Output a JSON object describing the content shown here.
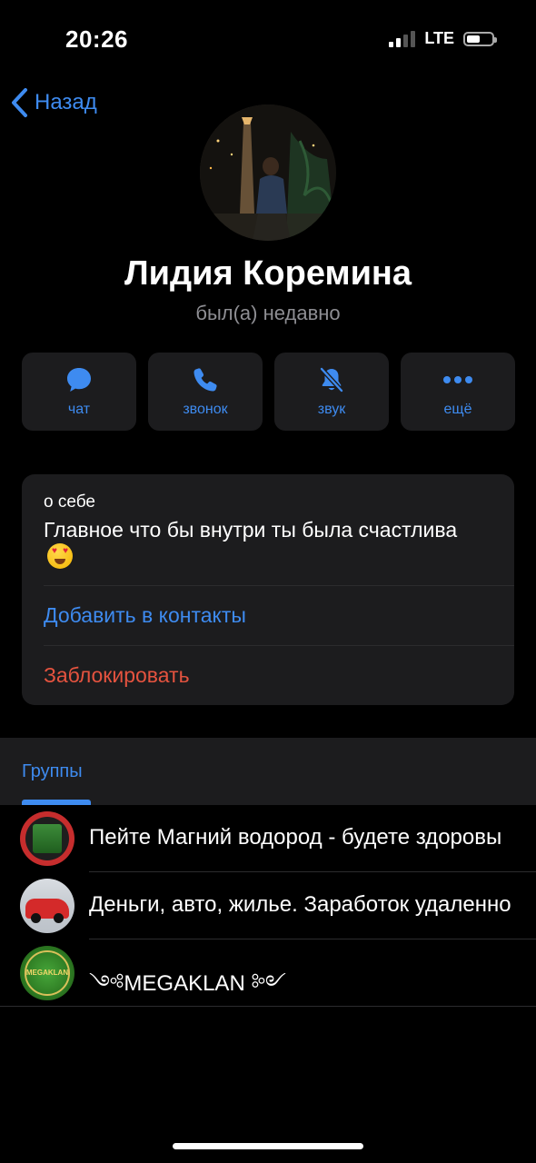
{
  "status_bar": {
    "time": "20:26",
    "network": "LTE",
    "signal_bars_active": 2,
    "signal_bars_total": 4,
    "battery_level": 0.55
  },
  "nav": {
    "back_label": "Назад",
    "back_icon": "chevron-left-icon"
  },
  "profile": {
    "name": "Лидия Коремина",
    "last_seen": "был(а) недавно"
  },
  "actions": [
    {
      "label": "чат",
      "icon": "chat-bubble-icon"
    },
    {
      "label": "звонок",
      "icon": "phone-icon"
    },
    {
      "label": "звук",
      "icon": "bell-slash-icon"
    },
    {
      "label": "ещё",
      "icon": "more-dots-icon"
    }
  ],
  "info": {
    "about_caption": "о себе",
    "about_text": "Главное что бы внутри ты была счастлива",
    "about_emoji": "heart-eyes-emoji",
    "add_contact": "Добавить в контакты",
    "block": "Заблокировать"
  },
  "groups": {
    "tab_label": "Группы",
    "items": [
      {
        "title": "Пейте Магний водород - будете здоровы"
      },
      {
        "title": "Деньги, авто, жилье. Заработок удаленно"
      },
      {
        "title": "༺MEGAKLAN ༻"
      }
    ]
  },
  "colors": {
    "background": "#000000",
    "card": "#1c1c1e",
    "accent": "#3e8bf0",
    "danger": "#e5533f",
    "secondary_text": "#8e8e93"
  }
}
